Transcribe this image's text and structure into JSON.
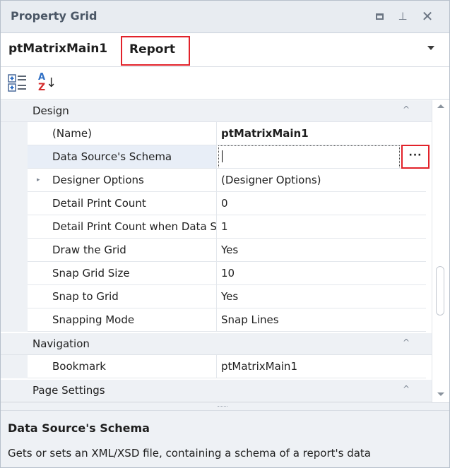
{
  "window": {
    "title": "Property Grid",
    "controls": [
      "maximize-icon",
      "pin-icon",
      "close-icon"
    ],
    "close_glyph": "✕",
    "pin_glyph": "⊥"
  },
  "selector": {
    "object_name": "ptMatrixMain1",
    "object_type": "Report"
  },
  "toolbar": {
    "categorized_icon": "categorized-icon",
    "alphabetical_icon": "sort-alphabetical-icon",
    "alpha_a": "A",
    "alpha_z": "Z",
    "alpha_arrow": "↓"
  },
  "grid": {
    "categories": [
      {
        "label": "Design",
        "expanded": true,
        "properties": [
          {
            "name": "(Name)",
            "value": "ptMatrixMain1",
            "bold": true
          },
          {
            "name": "Data Source's Schema",
            "value": "",
            "selected": true,
            "editing": true,
            "has_ellipsis": true,
            "ellipsis_label": "···"
          },
          {
            "name": "Designer Options",
            "value": "(Designer Options)",
            "expandable": true
          },
          {
            "name": "Detail Print Count",
            "value": "0"
          },
          {
            "name": "Detail Print Count when Data Source is Empty",
            "value": "1"
          },
          {
            "name": "Draw the Grid",
            "value": "Yes"
          },
          {
            "name": "Snap Grid Size",
            "value": "10"
          },
          {
            "name": "Snap to Grid",
            "value": "Yes"
          },
          {
            "name": "Snapping Mode",
            "value": "Snap Lines"
          }
        ]
      },
      {
        "label": "Navigation",
        "expanded": true,
        "properties": [
          {
            "name": "Bookmark",
            "value": "ptMatrixMain1"
          }
        ]
      },
      {
        "label": "Page Settings",
        "expanded": true,
        "properties": []
      }
    ],
    "collapse_glyph": "^",
    "expand_glyph": "▸"
  },
  "scrollbar": {
    "position_fraction": 0.55
  },
  "description": {
    "title": "Data Source's Schema",
    "text": "Gets or sets an XML/XSD file, containing a schema of a report's data"
  },
  "colors": {
    "highlight_border": "#e2222a",
    "header_bg": "#e8ecf1",
    "category_bg": "#eef1f5"
  }
}
